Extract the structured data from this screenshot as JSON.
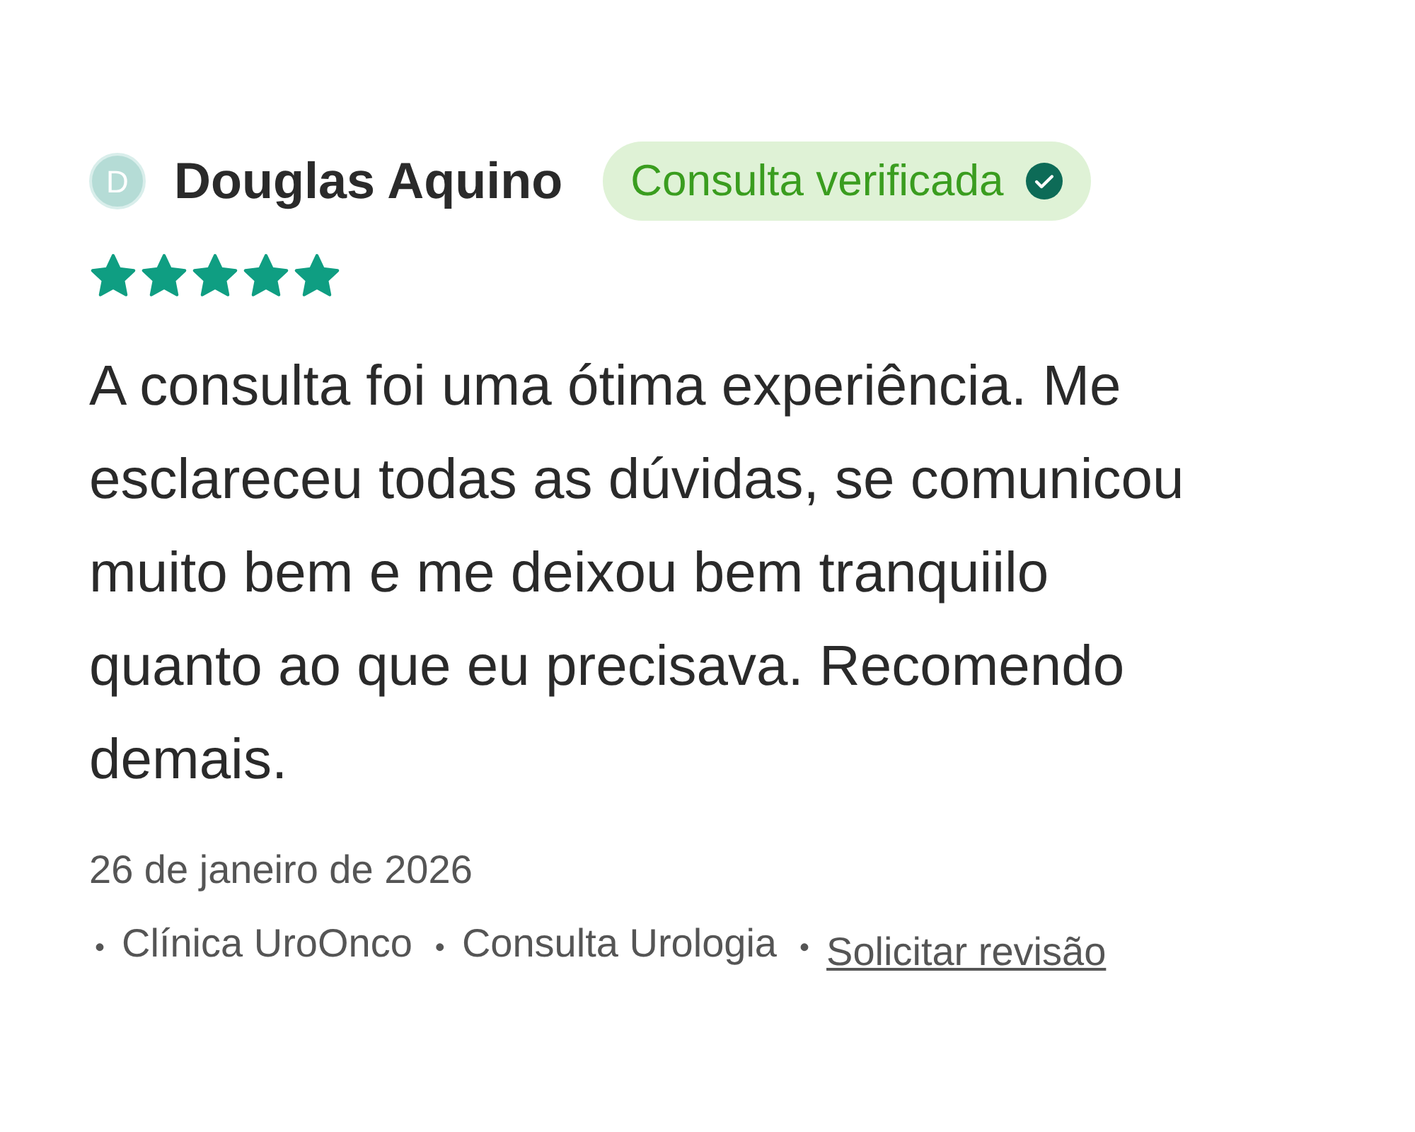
{
  "review": {
    "avatar_initial": "D",
    "author": "Douglas Aquino",
    "badge": {
      "label": "Consulta verificada",
      "verified": true
    },
    "stars": 5,
    "text": "A consulta foi uma ótima experiência. Me esclareceu todas as dúvidas, se comunicou muito bem e me deixou bem tranquiilo quanto ao que eu precisava. Recomendo demais.",
    "date": "26 de janeiro de 2026",
    "meta": [
      {
        "kind": "separator",
        "text": "•"
      },
      {
        "kind": "text",
        "text": "Clínica UroOnco"
      },
      {
        "kind": "separator",
        "text": "•"
      },
      {
        "kind": "text",
        "text": "Consulta Urologia"
      },
      {
        "kind": "separator",
        "text": "•"
      },
      {
        "kind": "link",
        "text": "Solicitar revisão"
      }
    ]
  }
}
